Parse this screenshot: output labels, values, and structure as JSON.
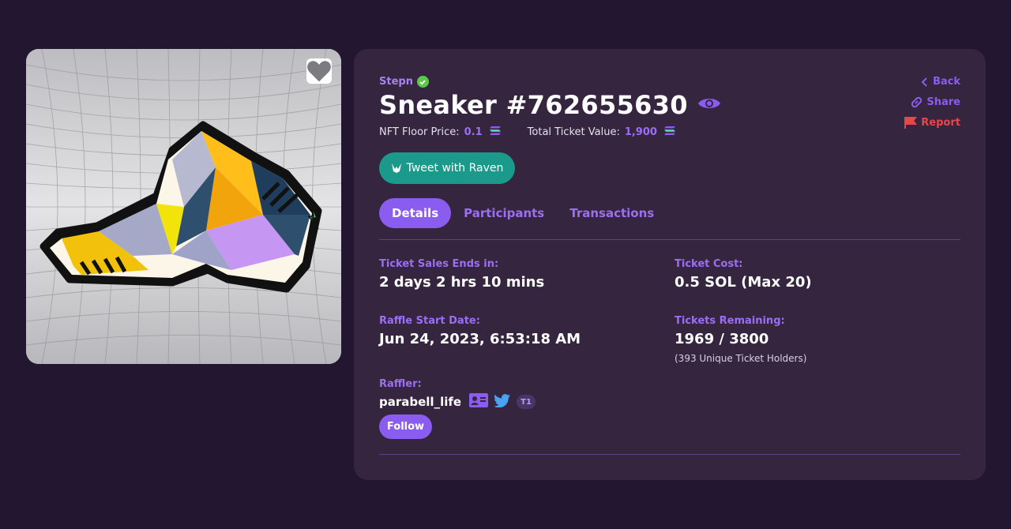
{
  "nft": {
    "collection": "Stepn",
    "title": "Sneaker #762655630",
    "floor_label": "NFT Floor Price:",
    "floor_value": "0.1",
    "total_label": "Total Ticket Value:",
    "total_value": "1,900",
    "image_icon": "sneaker-artwork",
    "favorite_icon": "heart-icon"
  },
  "actions": {
    "tweet_label": "Tweet with Raven",
    "back": "Back",
    "share": "Share",
    "report": "Report"
  },
  "tabs": [
    {
      "label": "Details",
      "active": true
    },
    {
      "label": "Participants",
      "active": false
    },
    {
      "label": "Transactions",
      "active": false
    }
  ],
  "details": {
    "sales_end_label": "Ticket Sales Ends in:",
    "sales_end_value": "2 days 2 hrs 10 mins",
    "cost_label": "Ticket Cost:",
    "cost_value": "0.5 SOL (Max 20)",
    "start_label": "Raffle Start Date:",
    "start_value": "Jun 24, 2023, 6:53:18 AM",
    "remaining_label": "Tickets Remaining:",
    "remaining_value": "1969 / 3800",
    "holders_note": "(393 Unique Ticket Holders)",
    "raffler_label": "Raffler:",
    "raffler_name": "parabell_life",
    "tier": "T1",
    "follow_label": "Follow"
  },
  "colors": {
    "background": "#231630",
    "panel": "#35253f",
    "accent": "#8a5cf0",
    "tweet": "#1b9a8b",
    "report": "#e8474a",
    "verified": "#5cc74a"
  }
}
